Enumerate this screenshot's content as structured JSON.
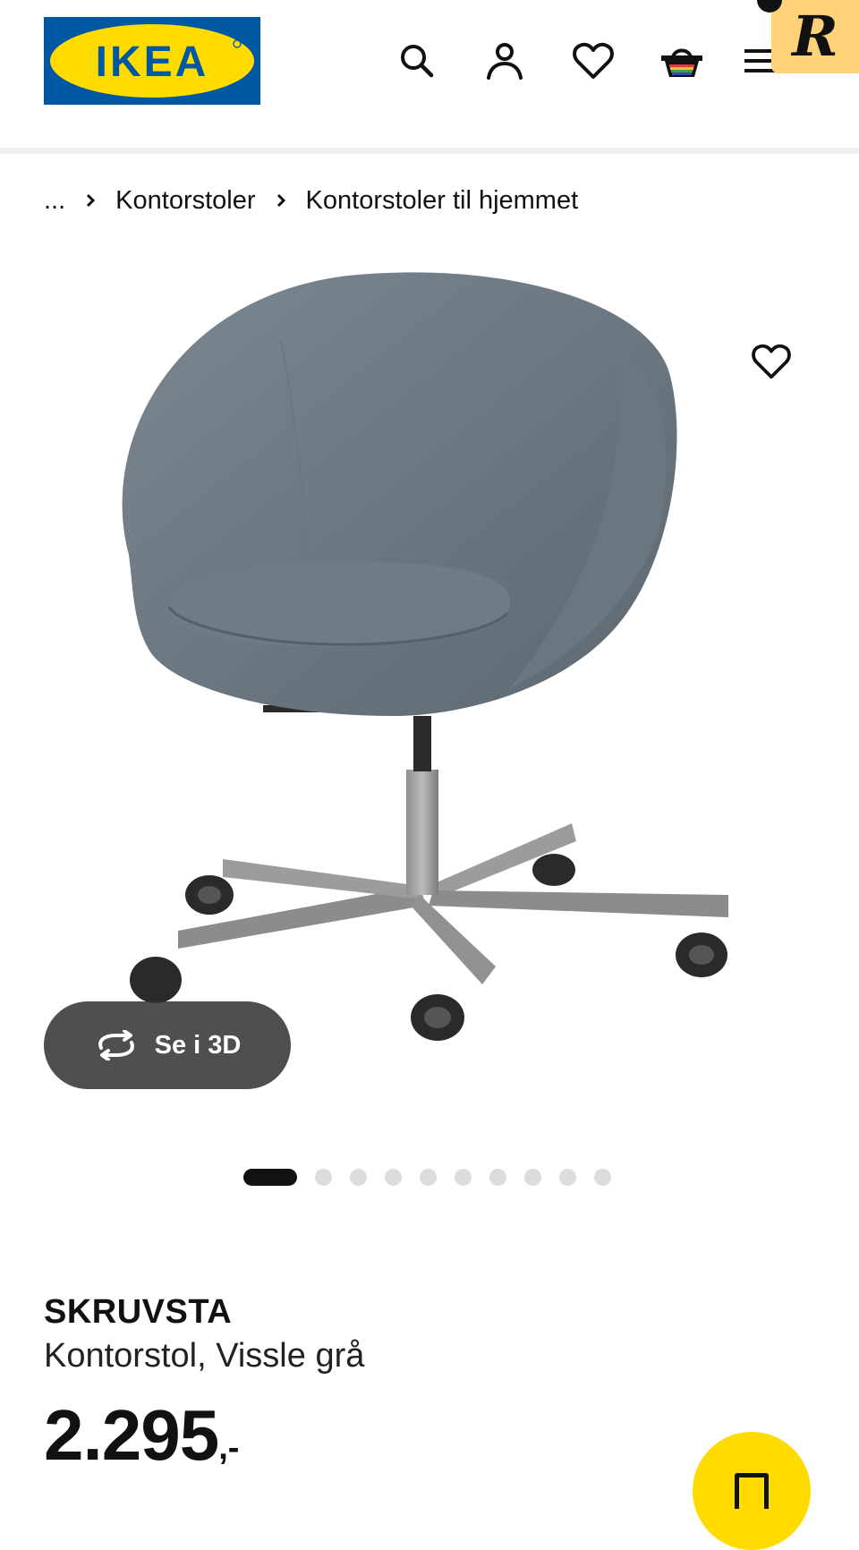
{
  "header": {
    "logo_text": "IKEA",
    "icons": [
      "search-icon",
      "account-icon",
      "heart-icon",
      "cart-icon",
      "menu-icon"
    ],
    "badge_letter": "R"
  },
  "breadcrumb": {
    "ellipsis": "...",
    "items": [
      "Kontorstoler",
      "Kontorstoler til hjemmet"
    ]
  },
  "gallery": {
    "view_3d_label": "Se i 3D",
    "dot_count": 10,
    "active_index": 0
  },
  "product": {
    "name": "SKRUVSTA",
    "description": "Kontorstol, Vissle grå",
    "price": "2.295",
    "price_suffix": ",-"
  },
  "colors": {
    "ikea_blue": "#0058a3",
    "ikea_yellow": "#ffdb00",
    "text": "#111111"
  }
}
